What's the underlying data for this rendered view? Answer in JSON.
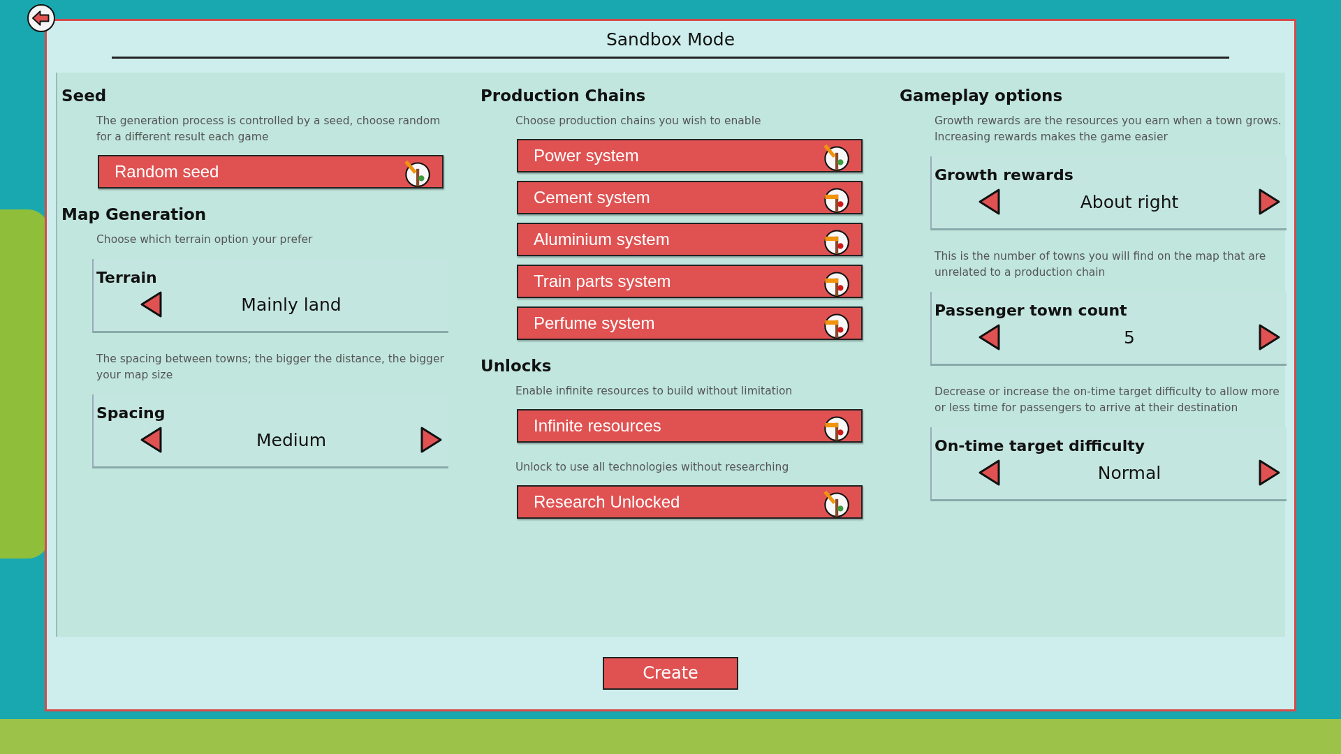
{
  "window": {
    "title": "Sandbox Mode"
  },
  "columns": [
    {
      "items": [
        {
          "kind": "heading",
          "text": "Seed"
        },
        {
          "kind": "description",
          "text": "The generation process is controlled by a seed, choose random for a different result each game"
        },
        {
          "kind": "toggle",
          "label": "Random seed",
          "on": true
        },
        {
          "kind": "heading",
          "text": "Map Generation"
        },
        {
          "kind": "description",
          "text": "Choose which terrain option your prefer"
        },
        {
          "kind": "selector",
          "title": "Terrain",
          "value": "Mainly land",
          "has_prev": true,
          "has_next": false
        },
        {
          "kind": "description",
          "text": "The spacing between towns; the bigger the distance, the bigger your map size"
        },
        {
          "kind": "selector",
          "title": "Spacing",
          "value": "Medium",
          "has_prev": true,
          "has_next": true
        }
      ]
    },
    {
      "items": [
        {
          "kind": "heading",
          "text": "Production Chains"
        },
        {
          "kind": "description",
          "text": "Choose production chains you wish to enable"
        },
        {
          "kind": "toggle",
          "label": "Power system",
          "on": true
        },
        {
          "kind": "toggle",
          "label": "Cement system",
          "on": false
        },
        {
          "kind": "toggle",
          "label": "Aluminium system",
          "on": false
        },
        {
          "kind": "toggle",
          "label": "Train parts system",
          "on": false
        },
        {
          "kind": "toggle",
          "label": "Perfume system",
          "on": false
        },
        {
          "kind": "heading",
          "text": "Unlocks"
        },
        {
          "kind": "description",
          "text": "Enable infinite resources to build without limitation"
        },
        {
          "kind": "toggle",
          "label": "Infinite resources",
          "on": false
        },
        {
          "kind": "description",
          "text": "Unlock to use all technologies without researching"
        },
        {
          "kind": "toggle",
          "label": "Research Unlocked",
          "on": true
        }
      ]
    },
    {
      "items": [
        {
          "kind": "heading",
          "text": "Gameplay options"
        },
        {
          "kind": "description",
          "text": "Growth rewards are the resources you earn when a town grows. Increasing rewards makes the game easier"
        },
        {
          "kind": "selector",
          "title": "Growth rewards",
          "value": "About right",
          "has_prev": true,
          "has_next": true
        },
        {
          "kind": "description",
          "text": "This is the number of towns you will find on the map that are unrelated to a production chain"
        },
        {
          "kind": "selector",
          "title": "Passenger town count",
          "value": "5",
          "has_prev": true,
          "has_next": true
        },
        {
          "kind": "description",
          "text": "Decrease or increase the on-time target difficulty to allow more or less time for passengers to arrive at their destination"
        },
        {
          "kind": "selector",
          "title": "On-time target difficulty",
          "value": "Normal",
          "has_prev": true,
          "has_next": true
        }
      ]
    }
  ],
  "create_button": "Create"
}
